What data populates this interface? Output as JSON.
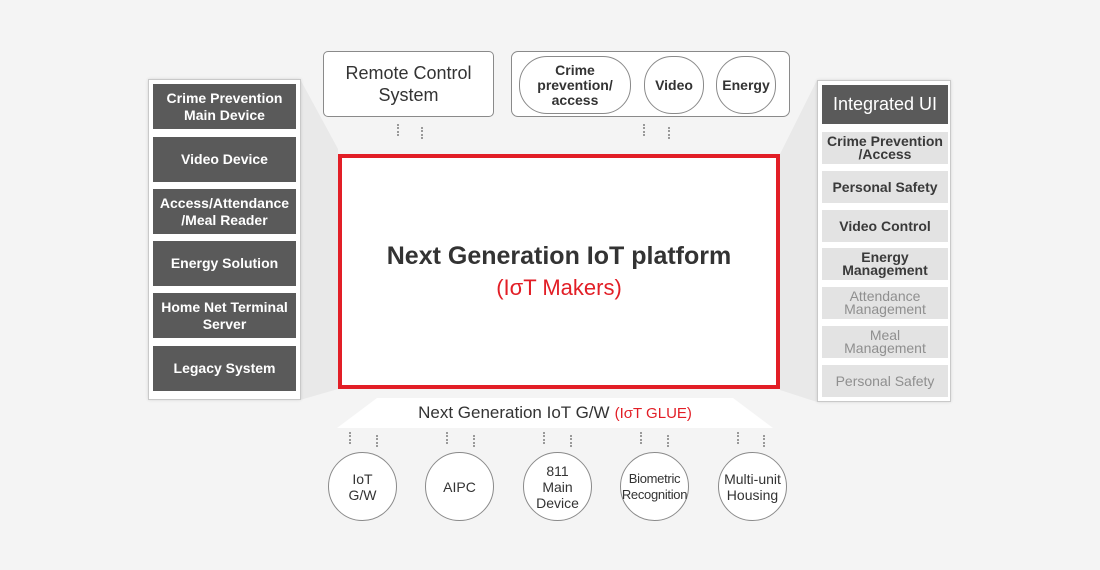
{
  "left_column": {
    "items": [
      "Crime Prevention\nMain Device",
      "Video Device",
      "Access/Attendance\n/Meal Reader",
      "Energy Solution",
      "Home Net Terminal\nServer",
      "Legacy System"
    ]
  },
  "right_column": {
    "header": "Integrated UI",
    "items": [
      {
        "label": "Crime Prevention\n/Access",
        "style": "dark"
      },
      {
        "label": "Personal Safety",
        "style": "dark"
      },
      {
        "label": "Video Control",
        "style": "dark"
      },
      {
        "label": "Energy\nManagement",
        "style": "dark"
      },
      {
        "label": "Attendance\nManagement",
        "style": "light"
      },
      {
        "label": "Meal\nManagement",
        "style": "light"
      },
      {
        "label": "Personal Safety",
        "style": "light"
      }
    ]
  },
  "top": {
    "remote_control": "Remote Control\nSystem",
    "services": [
      "Crime\nprevention/\naccess",
      "Video",
      "Energy"
    ]
  },
  "platform": {
    "title": "Next Generation IoT platform",
    "subtitle": "(IσT Makers)"
  },
  "gateway": {
    "label": "Next Generation IoT G/W",
    "highlight": "(IσT GLUE)"
  },
  "devices": [
    "IoT\nG/W",
    "AIPC",
    "811\nMain\nDevice",
    "Biometric\nRecognition",
    "Multi-unit\nHousing"
  ],
  "colors": {
    "accent": "#e21e26",
    "dark_box": "#5a5a5a",
    "light_box": "#e3e3e3",
    "background": "#f4f4f4"
  }
}
